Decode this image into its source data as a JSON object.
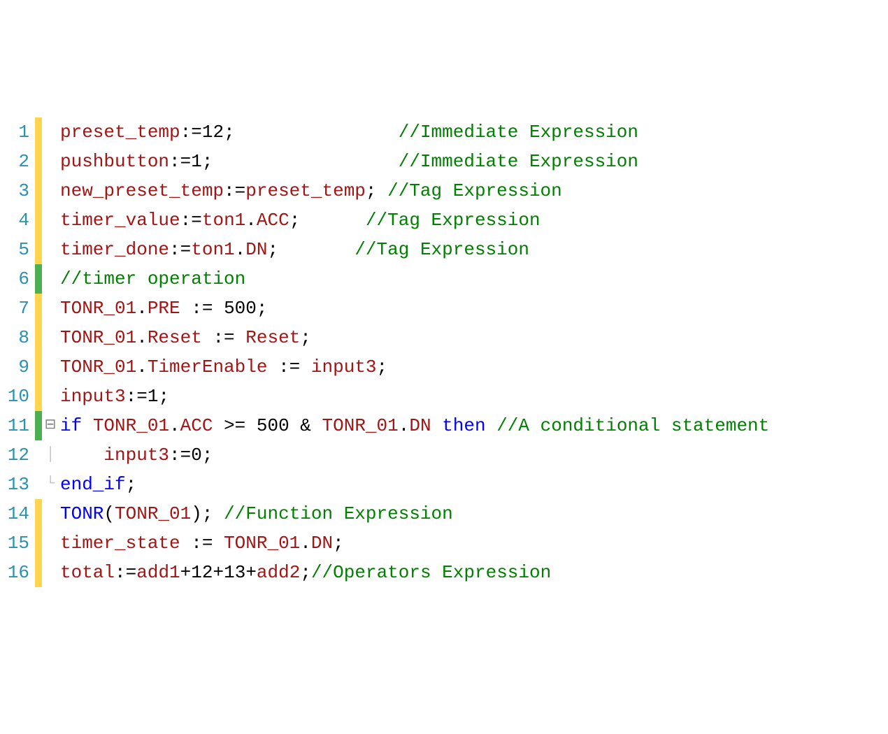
{
  "lines": [
    {
      "num": "1",
      "marker": "yellow",
      "fold": "",
      "tokens": [
        {
          "t": "preset_temp",
          "c": "tk-var"
        },
        {
          "t": ":=",
          "c": "tk-op"
        },
        {
          "t": "12",
          "c": "tk-num"
        },
        {
          "t": ";",
          "c": "tk-op"
        },
        {
          "t": "               ",
          "c": "tk-plain"
        },
        {
          "t": "//Immediate Expression",
          "c": "tk-cmt"
        }
      ]
    },
    {
      "num": "2",
      "marker": "yellow",
      "fold": "",
      "tokens": [
        {
          "t": "pushbutton",
          "c": "tk-var"
        },
        {
          "t": ":=",
          "c": "tk-op"
        },
        {
          "t": "1",
          "c": "tk-num"
        },
        {
          "t": ";",
          "c": "tk-op"
        },
        {
          "t": "                 ",
          "c": "tk-plain"
        },
        {
          "t": "//Immediate Expression",
          "c": "tk-cmt"
        }
      ]
    },
    {
      "num": "3",
      "marker": "yellow",
      "fold": "",
      "tokens": [
        {
          "t": "new_preset_temp",
          "c": "tk-var"
        },
        {
          "t": ":=",
          "c": "tk-op"
        },
        {
          "t": "preset_temp",
          "c": "tk-var"
        },
        {
          "t": ";",
          "c": "tk-op"
        },
        {
          "t": " ",
          "c": "tk-plain"
        },
        {
          "t": "//Tag Expression",
          "c": "tk-cmt"
        }
      ]
    },
    {
      "num": "4",
      "marker": "yellow",
      "fold": "",
      "tokens": [
        {
          "t": "timer_value",
          "c": "tk-var"
        },
        {
          "t": ":=",
          "c": "tk-op"
        },
        {
          "t": "ton1",
          "c": "tk-var"
        },
        {
          "t": ".",
          "c": "tk-op"
        },
        {
          "t": "ACC",
          "c": "tk-var"
        },
        {
          "t": ";",
          "c": "tk-op"
        },
        {
          "t": "      ",
          "c": "tk-plain"
        },
        {
          "t": "//Tag Expression",
          "c": "tk-cmt"
        }
      ]
    },
    {
      "num": "5",
      "marker": "yellow",
      "fold": "",
      "tokens": [
        {
          "t": "timer_done",
          "c": "tk-var"
        },
        {
          "t": ":=",
          "c": "tk-op"
        },
        {
          "t": "ton1",
          "c": "tk-var"
        },
        {
          "t": ".",
          "c": "tk-op"
        },
        {
          "t": "DN",
          "c": "tk-var"
        },
        {
          "t": ";",
          "c": "tk-op"
        },
        {
          "t": "       ",
          "c": "tk-plain"
        },
        {
          "t": "//Tag Expression",
          "c": "tk-cmt"
        }
      ]
    },
    {
      "num": "6",
      "marker": "green",
      "fold": "",
      "tokens": [
        {
          "t": "//timer operation",
          "c": "tk-cmt"
        }
      ]
    },
    {
      "num": "7",
      "marker": "yellow",
      "fold": "",
      "tokens": [
        {
          "t": "TONR_01",
          "c": "tk-var"
        },
        {
          "t": ".",
          "c": "tk-op"
        },
        {
          "t": "PRE",
          "c": "tk-var"
        },
        {
          "t": " := ",
          "c": "tk-op"
        },
        {
          "t": "500",
          "c": "tk-num"
        },
        {
          "t": ";",
          "c": "tk-op"
        }
      ]
    },
    {
      "num": "8",
      "marker": "yellow",
      "fold": "",
      "tokens": [
        {
          "t": "TONR_01",
          "c": "tk-var"
        },
        {
          "t": ".",
          "c": "tk-op"
        },
        {
          "t": "Reset",
          "c": "tk-var"
        },
        {
          "t": " := ",
          "c": "tk-op"
        },
        {
          "t": "Reset",
          "c": "tk-var"
        },
        {
          "t": ";",
          "c": "tk-op"
        }
      ]
    },
    {
      "num": "9",
      "marker": "yellow",
      "fold": "",
      "tokens": [
        {
          "t": "TONR_01",
          "c": "tk-var"
        },
        {
          "t": ".",
          "c": "tk-op"
        },
        {
          "t": "TimerEnable",
          "c": "tk-var"
        },
        {
          "t": " := ",
          "c": "tk-op"
        },
        {
          "t": "input3",
          "c": "tk-var"
        },
        {
          "t": ";",
          "c": "tk-op"
        }
      ]
    },
    {
      "num": "10",
      "marker": "yellow",
      "fold": "",
      "tokens": [
        {
          "t": "input3",
          "c": "tk-var"
        },
        {
          "t": ":=",
          "c": "tk-op"
        },
        {
          "t": "1",
          "c": "tk-num"
        },
        {
          "t": ";",
          "c": "tk-op"
        }
      ]
    },
    {
      "num": "11",
      "marker": "green",
      "fold": "⊟",
      "tokens": [
        {
          "t": "if",
          "c": "tk-kw"
        },
        {
          "t": " ",
          "c": "tk-plain"
        },
        {
          "t": "TONR_01",
          "c": "tk-var"
        },
        {
          "t": ".",
          "c": "tk-op"
        },
        {
          "t": "ACC",
          "c": "tk-var"
        },
        {
          "t": " >= ",
          "c": "tk-op"
        },
        {
          "t": "500",
          "c": "tk-num"
        },
        {
          "t": " & ",
          "c": "tk-op"
        },
        {
          "t": "TONR_01",
          "c": "tk-var"
        },
        {
          "t": ".",
          "c": "tk-op"
        },
        {
          "t": "DN",
          "c": "tk-var"
        },
        {
          "t": " ",
          "c": "tk-plain"
        },
        {
          "t": "then",
          "c": "tk-kw"
        },
        {
          "t": " ",
          "c": "tk-plain"
        },
        {
          "t": "//A conditional statement",
          "c": "tk-cmt"
        }
      ]
    },
    {
      "num": "12",
      "marker": "none",
      "fold": "│",
      "tokens": [
        {
          "t": "    ",
          "c": "tk-plain"
        },
        {
          "t": "input3",
          "c": "tk-var"
        },
        {
          "t": ":=",
          "c": "tk-op"
        },
        {
          "t": "0",
          "c": "tk-num"
        },
        {
          "t": ";",
          "c": "tk-op"
        }
      ]
    },
    {
      "num": "13",
      "marker": "none",
      "fold": "└",
      "tokens": [
        {
          "t": "end_if",
          "c": "tk-kw"
        },
        {
          "t": ";",
          "c": "tk-op"
        }
      ]
    },
    {
      "num": "14",
      "marker": "yellow",
      "fold": "",
      "tokens": [
        {
          "t": "TONR",
          "c": "tk-func"
        },
        {
          "t": "(",
          "c": "tk-op"
        },
        {
          "t": "TONR_01",
          "c": "tk-var"
        },
        {
          "t": ")",
          "c": "tk-op"
        },
        {
          "t": ";",
          "c": "tk-op"
        },
        {
          "t": " ",
          "c": "tk-plain"
        },
        {
          "t": "//Function Expression",
          "c": "tk-cmt"
        }
      ]
    },
    {
      "num": "15",
      "marker": "yellow",
      "fold": "",
      "tokens": [
        {
          "t": "timer_state",
          "c": "tk-var"
        },
        {
          "t": " := ",
          "c": "tk-op"
        },
        {
          "t": "TONR_01",
          "c": "tk-var"
        },
        {
          "t": ".",
          "c": "tk-op"
        },
        {
          "t": "DN",
          "c": "tk-var"
        },
        {
          "t": ";",
          "c": "tk-op"
        }
      ]
    },
    {
      "num": "16",
      "marker": "yellow",
      "fold": "",
      "tokens": [
        {
          "t": "total",
          "c": "tk-var"
        },
        {
          "t": ":=",
          "c": "tk-op"
        },
        {
          "t": "add1",
          "c": "tk-var"
        },
        {
          "t": "+",
          "c": "tk-op"
        },
        {
          "t": "12",
          "c": "tk-num"
        },
        {
          "t": "+",
          "c": "tk-op"
        },
        {
          "t": "13",
          "c": "tk-num"
        },
        {
          "t": "+",
          "c": "tk-op"
        },
        {
          "t": "add2",
          "c": "tk-var"
        },
        {
          "t": ";",
          "c": "tk-op"
        },
        {
          "t": "//Operators Expression",
          "c": "tk-cmt"
        }
      ]
    }
  ]
}
